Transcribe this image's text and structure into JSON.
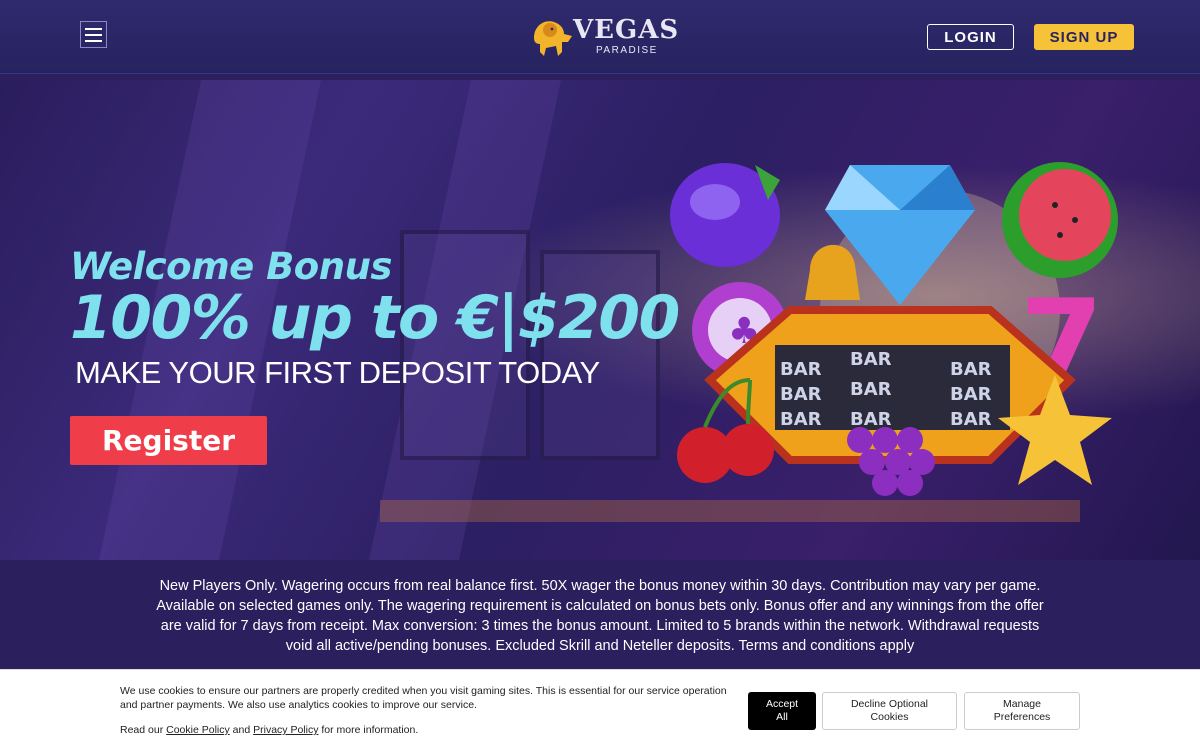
{
  "header": {
    "logo_text": "VEGAS",
    "logo_sub": "PARADISE",
    "login_label": "LOGIN",
    "signup_label": "SIGN UP"
  },
  "hero": {
    "welcome": "Welcome Bonus",
    "headline": "100% up to €|$200",
    "subline": "MAKE YOUR FIRST DEPOSIT TODAY",
    "register_label": "Register",
    "reel_symbol": "BAR"
  },
  "terms": "New Players Only. Wagering occurs from real balance first. 50X wager the bonus money within 30 days. Contribution may vary per game. Available on selected games only. The wagering requirement is calculated on bonus bets only. Bonus offer and any winnings from the offer are valid for 7 days from receipt. Max conversion: 3 times the bonus amount. Limited to 5 brands within the network. Withdrawal requests void all active/pending bonuses. Excluded Skrill and Neteller deposits. Terms and conditions apply",
  "cookie": {
    "text": "We use cookies to ensure our partners are properly credited when you visit gaming sites. This is essential for our service operation and partner payments. We also use analytics cookies to improve our service.",
    "read_prefix": "Read our ",
    "cookie_policy": "Cookie Policy",
    "and": " and ",
    "privacy_policy": "Privacy Policy",
    "read_suffix": " for more information.",
    "accept_line1": "Accept",
    "accept_line2": "All",
    "decline_line1": "Decline Optional",
    "decline_line2": "Cookies",
    "manage_line1": "Manage",
    "manage_line2": "Preferences"
  },
  "colors": {
    "header_bg": "#2e2a6e",
    "accent_cyan": "#7fe1ee",
    "signup_yellow": "#f6c338",
    "register_red": "#ef3e4a"
  }
}
